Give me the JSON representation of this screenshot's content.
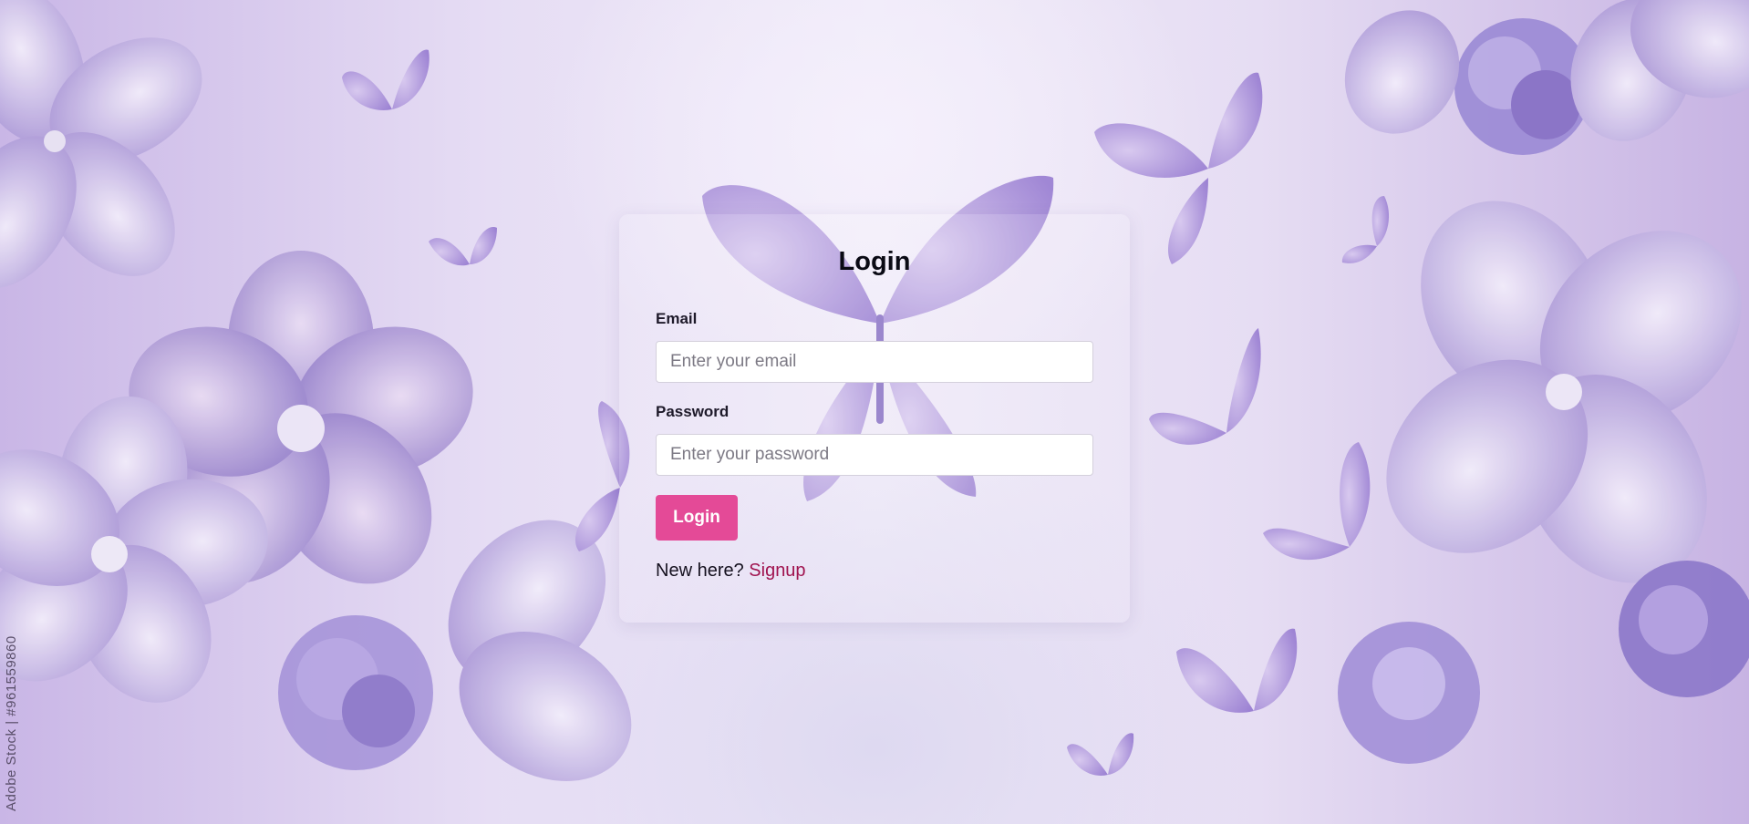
{
  "watermark": "Adobe Stock | #961559860",
  "login_card": {
    "title": "Login",
    "email": {
      "label": "Email",
      "value": "",
      "placeholder": "Enter your email"
    },
    "password": {
      "label": "Password",
      "value": "",
      "placeholder": "Enter your password"
    },
    "submit_label": "Login",
    "signup_prompt": "New here?",
    "signup_link": "Signup"
  },
  "colors": {
    "accent_button": "#e44a97",
    "signup_link": "#a0134f",
    "background_primary": "#c9b6e6"
  }
}
